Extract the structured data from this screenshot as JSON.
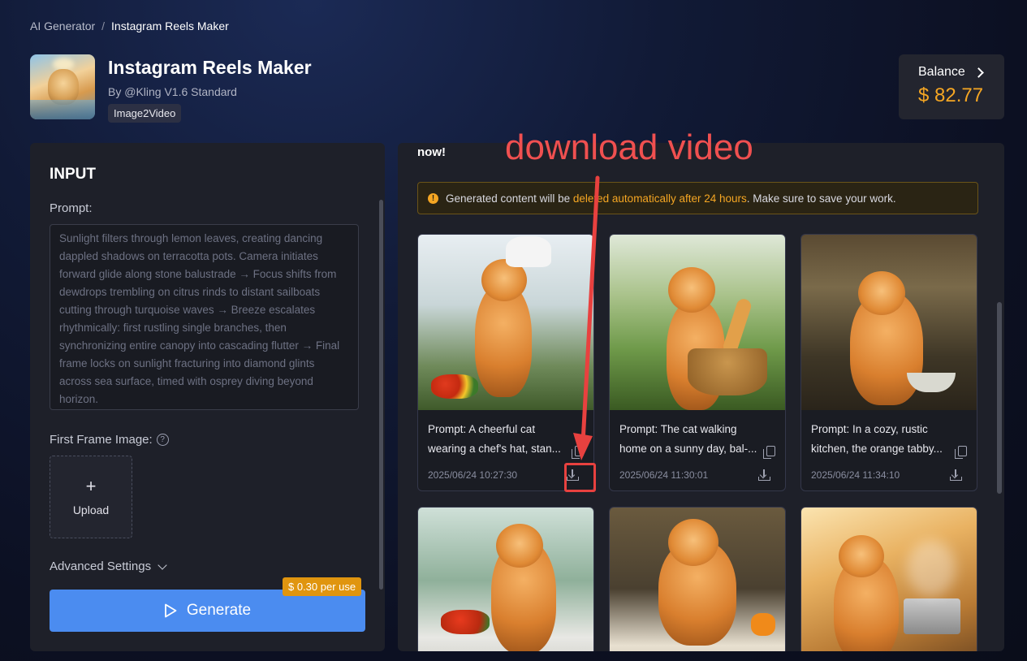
{
  "breadcrumb": {
    "root": "AI Generator",
    "separator": "/",
    "current": "Instagram Reels Maker"
  },
  "header": {
    "title": "Instagram Reels Maker",
    "byline": "By @Kling V1.6 Standard",
    "tag": "Image2Video"
  },
  "balance": {
    "label": "Balance",
    "value": "$ 82.77"
  },
  "input_panel": {
    "title": "INPUT",
    "prompt_label": "Prompt:",
    "prompt_placeholder": "Sunlight filters through lemon leaves, creating dancing dappled shadows on terracotta pots. Camera initiates forward glide along stone balustrade → Focus shifts from dewdrops trembling on citrus rinds to distant sailboats cutting through turquoise waves → Breeze escalates rhythmically: first rustling single branches, then synchronizing entire canopy into cascading flutter → Final frame locks on sunlight fracturing into diamond glints across sea surface, timed with osprey diving beyond horizon.",
    "first_frame_label": "First Frame Image:",
    "help_glyph": "?",
    "upload_plus": "+",
    "upload_label": "Upload",
    "advanced_label": "Advanced Settings",
    "generate_label": "Generate",
    "price_badge": "$ 0.30 per use"
  },
  "results_panel": {
    "now_text": "now!",
    "notice_prefix": "Generated content will be ",
    "notice_highlight": "deleted automatically after 24 hours",
    "notice_suffix": ". Make sure to save your work.",
    "warn_glyph": "!",
    "cards": [
      {
        "prompt": "Prompt: A cheerful cat wearing a chef's hat, stan...",
        "timestamp": "2025/06/24 10:27:30"
      },
      {
        "prompt": "Prompt: The cat walking home on a sunny day, bal-...",
        "timestamp": "2025/06/24 11:30:01"
      },
      {
        "prompt": "Prompt: In a cozy, rustic kitchen, the orange tabby...",
        "timestamp": "2025/06/24 11:34:10"
      }
    ]
  },
  "annotation": {
    "text": "download video",
    "color": "#f05050"
  },
  "colors": {
    "accent": "#4b8cf0",
    "price": "#f5a623",
    "annotation_red": "#e8413f"
  },
  "icons": [
    "chevron-right-icon",
    "help-icon",
    "plus-icon",
    "chevron-down-icon",
    "play-icon",
    "warning-icon",
    "copy-icon",
    "download-icon"
  ]
}
